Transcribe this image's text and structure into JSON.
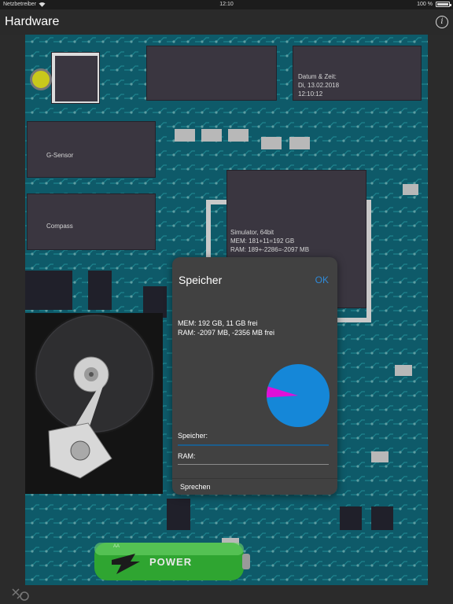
{
  "status_bar": {
    "carrier": "Netzbetreiber",
    "time": "12:10",
    "battery": "100 %"
  },
  "nav": {
    "title": "Hardware",
    "info_glyph": "i"
  },
  "board": {
    "datetime_label": "Datum & Zeit:",
    "datetime_date": "Di, 13.02.2018",
    "datetime_time": "12:10:12",
    "gsensor_label": "G-Sensor",
    "compass_label": "Compass",
    "cpu_line1": "Simulator, 64bit",
    "cpu_line2": "MEM: 181+11=192 GB",
    "cpu_line3": "RAM: 189+-2286=-2097 MB",
    "battery_label": "POWER",
    "battery_small": "AA"
  },
  "dialog": {
    "title": "Speicher",
    "ok_label": "OK",
    "mem_line": "MEM:  192 GB, 11 GB frei",
    "ram_line": "RAM: -2097 MB, -2356 MB frei",
    "storage_label": "Speicher:",
    "ram_label": "RAM:",
    "speak_label": "Sprechen"
  },
  "pie": {
    "used_color": "#1587d8",
    "free_color": "#e010d8",
    "free_fraction": 0.057
  },
  "colors": {
    "accent": "#2f8ad8",
    "board": "#0e5a69"
  },
  "icons": {
    "bottom_left": "tools-icon",
    "info": "info-icon",
    "wifi": "wifi-icon"
  }
}
